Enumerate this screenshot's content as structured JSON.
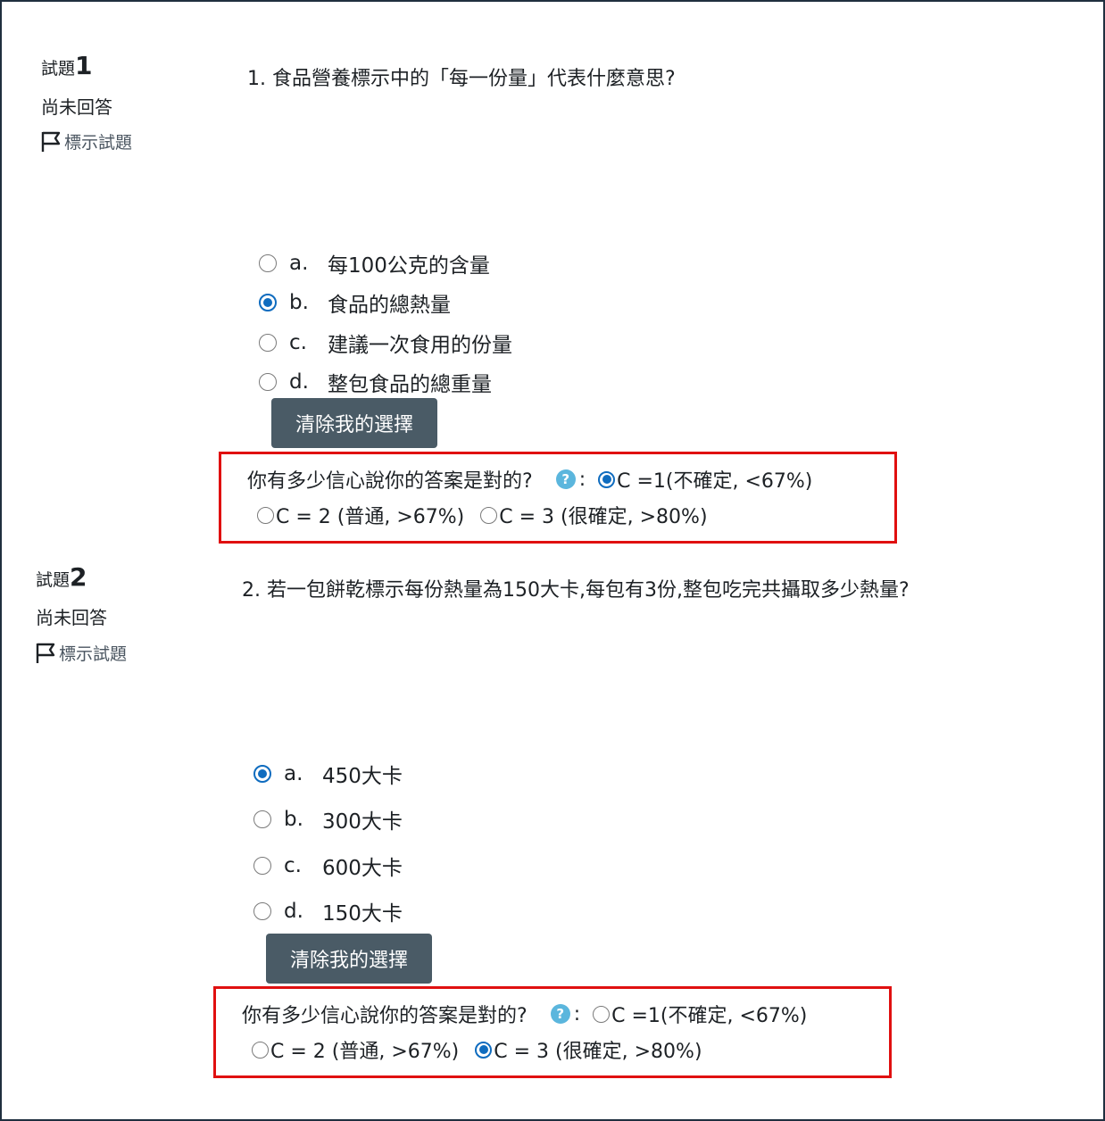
{
  "questions": [
    {
      "label": "試題",
      "number": "1",
      "state": "尚未回答",
      "flag": "標示試題",
      "text": "1. 食品營養標示中的「每一份量」代表什麼意思?",
      "answers": [
        {
          "letter": "a.",
          "text": "每100公克的含量",
          "checked": false
        },
        {
          "letter": "b.",
          "text": "食品的總熱量",
          "checked": true
        },
        {
          "letter": "c.",
          "text": "建議一次食用的份量",
          "checked": false
        },
        {
          "letter": "d.",
          "text": "整包食品的總重量",
          "checked": false
        }
      ],
      "clear_label": "清除我的選擇",
      "confidence": {
        "prompt": "你有多少信心說你的答案是對的?",
        "help_icon": "help-question-icon",
        "colon": ":",
        "options": [
          {
            "text": "C =1(不確定, <67%)",
            "checked": true
          },
          {
            "text": "C = 2 (普通, >67%)",
            "checked": false
          },
          {
            "text": "C = 3 (很確定, >80%)",
            "checked": false
          }
        ]
      }
    },
    {
      "label": "試題",
      "number": "2",
      "state": "尚未回答",
      "flag": "標示試題",
      "text": "2. 若一包餅乾標示每份熱量為150大卡,每包有3份,整包吃完共攝取多少熱量?",
      "answers": [
        {
          "letter": "a.",
          "text": "450大卡",
          "checked": true
        },
        {
          "letter": "b.",
          "text": "300大卡",
          "checked": false
        },
        {
          "letter": "c.",
          "text": "600大卡",
          "checked": false
        },
        {
          "letter": "d.",
          "text": "150大卡",
          "checked": false
        }
      ],
      "clear_label": "清除我的選擇",
      "confidence": {
        "prompt": "你有多少信心說你的答案是對的?",
        "help_icon": "help-question-icon",
        "colon": ":",
        "options": [
          {
            "text": "C =1(不確定, <67%)",
            "checked": false
          },
          {
            "text": "C = 2 (普通, >67%)",
            "checked": false
          },
          {
            "text": "C = 3 (很確定, >80%)",
            "checked": true
          }
        ]
      }
    }
  ],
  "colors": {
    "accent": "#0f6cbf",
    "highlight_box": "#e01010",
    "button": "#4a5b66",
    "help": "#5bb6dd"
  }
}
